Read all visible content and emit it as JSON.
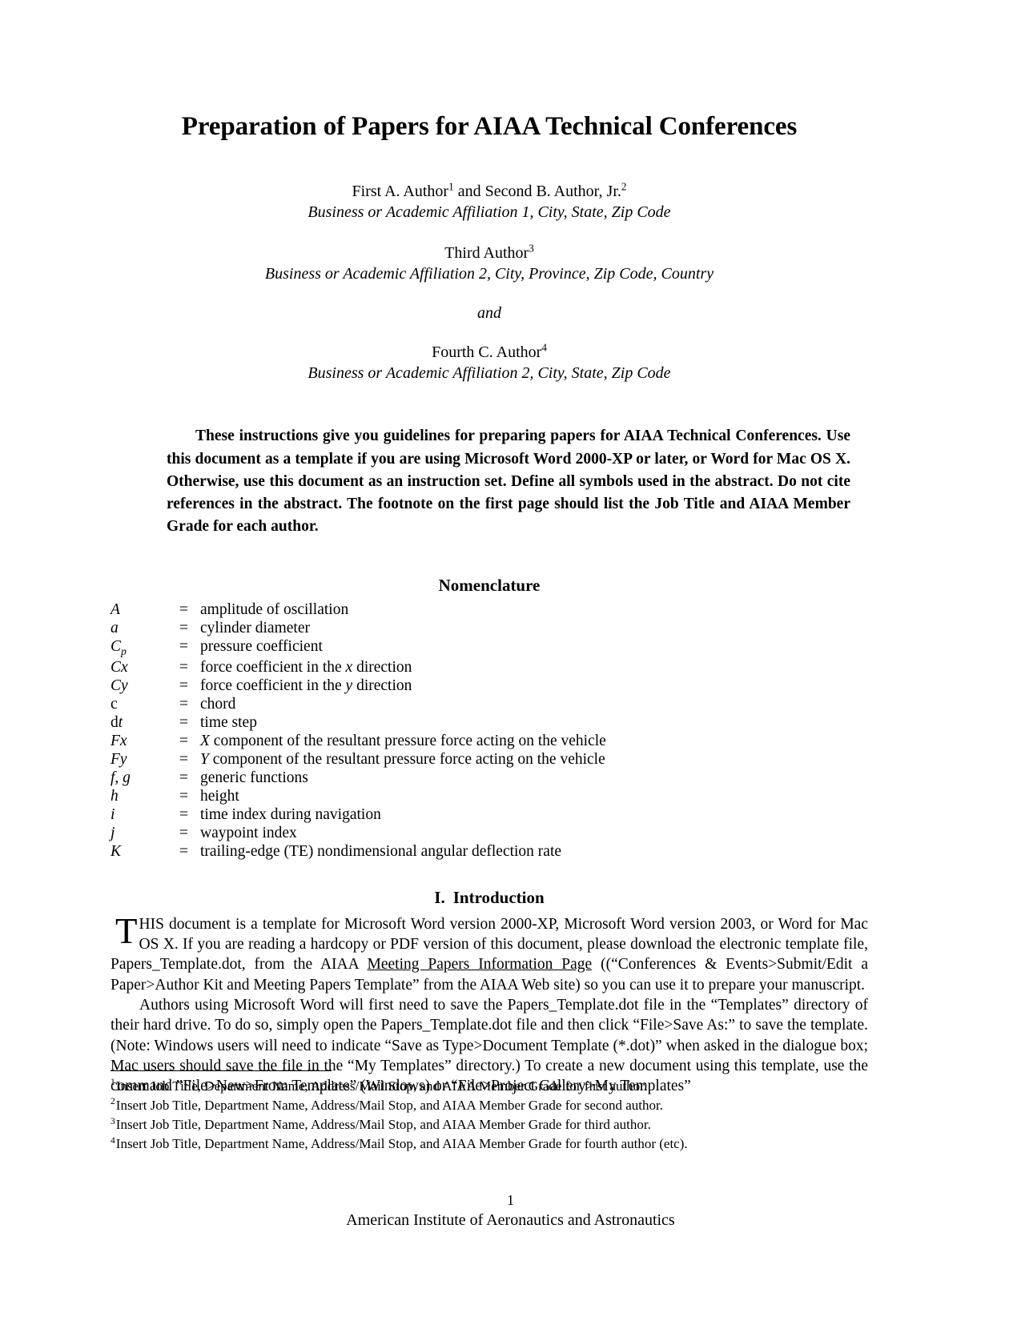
{
  "document": {
    "title": "Preparation of Papers for AIAA Technical Conferences"
  },
  "authors": {
    "groups": [
      {
        "names_prefix": "First A. Author",
        "names_sup1": "1",
        "names_middle": " and Second B. Author, Jr.",
        "names_sup2": "2",
        "affiliation": "Business or Academic Affiliation 1, City, State, Zip Code"
      },
      {
        "names_prefix": "Third Author",
        "names_sup1": "3",
        "names_middle": "",
        "names_sup2": "",
        "affiliation": "Business or Academic Affiliation 2, City, Province, Zip Code, Country"
      },
      {
        "names_prefix": "Fourth C. Author",
        "names_sup1": "4",
        "names_middle": "",
        "names_sup2": "",
        "affiliation": "Business or Academic Affiliation 2, City, State, Zip Code"
      }
    ],
    "conjunction": "and"
  },
  "abstract": {
    "text": "These instructions give you guidelines for preparing papers for AIAA Technical Conferences. Use this document as a template if you are using Microsoft Word 2000-XP or later, or Word for Mac OS X. Otherwise, use this document as an instruction set. Define all symbols used in the abstract. Do not cite references in the abstract. The footnote on the first page should list the Job Title and AIAA Member Grade for each author."
  },
  "nomenclature": {
    "heading": "Nomenclature",
    "equals": "=",
    "entries": [
      {
        "symbol": "A",
        "upright": false,
        "def_pre": "amplitude of oscillation",
        "def_italic": "",
        "def_post": ""
      },
      {
        "symbol": "a",
        "upright": false,
        "def_pre": "cylinder diameter",
        "def_italic": "",
        "def_post": ""
      },
      {
        "symbol": "Cp",
        "upright": false,
        "def_pre": "pressure coefficient",
        "def_italic": "",
        "def_post": ""
      },
      {
        "symbol": "Cx",
        "upright": false,
        "def_pre": "force coefficient in the ",
        "def_italic": "x",
        "def_post": " direction"
      },
      {
        "symbol": "Cy",
        "upright": false,
        "def_pre": "force coefficient in the ",
        "def_italic": "y",
        "def_post": " direction"
      },
      {
        "symbol": "c",
        "upright": true,
        "def_pre": "chord",
        "def_italic": "",
        "def_post": ""
      },
      {
        "symbol": "dt",
        "upright": false,
        "def_pre": "time step",
        "def_italic": "",
        "def_post": ""
      },
      {
        "symbol": "Fx",
        "upright": false,
        "def_pre": "",
        "def_italic": "X",
        "def_post": " component of the resultant pressure force acting on the vehicle"
      },
      {
        "symbol": "Fy",
        "upright": false,
        "def_pre": "",
        "def_italic": "Y",
        "def_post": " component of the resultant pressure force acting on the vehicle"
      },
      {
        "symbol": "f, g",
        "upright": false,
        "def_pre": "generic functions",
        "def_italic": "",
        "def_post": ""
      },
      {
        "symbol": "h",
        "upright": false,
        "def_pre": "height",
        "def_italic": "",
        "def_post": ""
      },
      {
        "symbol": "i",
        "upright": false,
        "def_pre": "time index during navigation",
        "def_italic": "",
        "def_post": ""
      },
      {
        "symbol": "j",
        "upright": false,
        "def_pre": "waypoint index",
        "def_italic": "",
        "def_post": ""
      },
      {
        "symbol": "K",
        "upright": false,
        "def_pre": "trailing-edge (TE) nondimensional angular deflection rate",
        "def_italic": "",
        "def_post": ""
      }
    ]
  },
  "introduction": {
    "numeral": "I.",
    "heading": "Introduction",
    "dropcap": "T",
    "paragraph1_a": "HIS document is a template for Microsoft Word version 2000-XP, Microsoft Word version 2003, or Word for Mac OS X. If you are reading a hardcopy or PDF version of this document, please download the electronic template file, Papers_Template.dot, from the AIAA ",
    "paragraph1_link": "Meeting Papers Information Page",
    "paragraph1_b": " ((“Conferences & Events>Submit/Edit a Paper>Author Kit and Meeting Papers Template” from the AIAA Web site) so you can use it to prepare your manuscript.",
    "paragraph2": "Authors using Microsoft Word will first need to save the Papers_Template.dot file in the “Templates” directory of their hard drive. To do so, simply open the Papers_Template.dot file and then click “File>Save As:” to save the template. (Note: Windows users will need to indicate “Save as Type>Document Template (*.dot)” when asked in the dialogue box; Mac users should save the file in the “My Templates” directory.) To create a new document using this template, use the command ”File>New>From Template” (Windows) or “File>Project Gallery>My Templates”"
  },
  "footnotes": [
    {
      "marker": "1",
      "text": "Insert Job Title, Department Name, Address/Mail Stop, and AIAA Member Grade for first author."
    },
    {
      "marker": "2",
      "text": "Insert Job Title, Department Name, Address/Mail Stop, and AIAA Member Grade for second author."
    },
    {
      "marker": "3",
      "text": "Insert Job Title, Department Name, Address/Mail Stop, and AIAA Member Grade for third author."
    },
    {
      "marker": "4",
      "text": "Insert Job Title, Department Name, Address/Mail Stop, and AIAA Member Grade for fourth author (etc)."
    }
  ],
  "footer": {
    "page_number": "1",
    "organization": "American Institute of Aeronautics and Astronautics"
  }
}
